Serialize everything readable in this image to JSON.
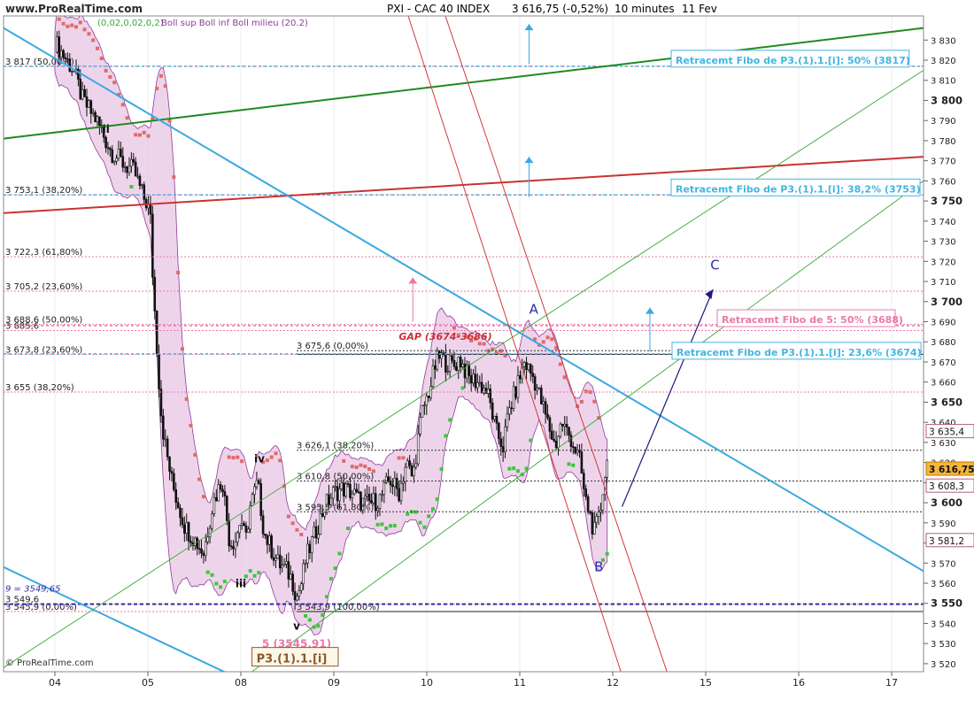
{
  "chart_data": {
    "type": "line",
    "title": "PXI - CAC 40 INDEX",
    "quote": "3 616,75 (-0,52%)",
    "timeframe": "10 minutes",
    "date": "11 Fev",
    "brand": "www.ProRealTime.com",
    "copyright": "© ProRealTime.com",
    "indicator_label": "Boll sup Boll inf Boll milieu (20.2)",
    "indicator_params": "(0,02,0,02,0,2)",
    "ylim": [
      3516,
      3842
    ],
    "y_ticks": [
      3520,
      3530,
      3540,
      3550,
      3560,
      3570,
      3580,
      3590,
      3600,
      3610,
      3620,
      3630,
      3640,
      3650,
      3660,
      3670,
      3680,
      3690,
      3700,
      3710,
      3720,
      3730,
      3740,
      3750,
      3760,
      3770,
      3780,
      3790,
      3800,
      3810,
      3820,
      3830
    ],
    "y_tick_labels": [
      "3 520",
      "3 530",
      "3 540",
      "3 550",
      "3 560",
      "3 570",
      "3 580",
      "3 590",
      "3 600",
      "3 610",
      "3 620",
      "3 630",
      "3 640",
      "3 650",
      "3 660",
      "3 670",
      "3 680",
      "3 690",
      "3 700",
      "3 710",
      "3 720",
      "3 730",
      "3 740",
      "3 750",
      "3 760",
      "3 770",
      "3 780",
      "3 790",
      "3 800",
      "3 810",
      "3 820",
      "3 830"
    ],
    "y_bold_ticks": [
      3550,
      3600,
      3650,
      3700,
      3750,
      3800
    ],
    "x_ticks": [
      0,
      1,
      2,
      3,
      4,
      5,
      6,
      7,
      8,
      9
    ],
    "x_tick_labels": [
      "04",
      "05",
      "08",
      "09",
      "10",
      "11",
      "12",
      "15",
      "16",
      "17"
    ],
    "price_path": [
      [
        0.0,
        3829
      ],
      [
        0.1,
        3822
      ],
      [
        0.2,
        3815
      ],
      [
        0.3,
        3800
      ],
      [
        0.45,
        3790
      ],
      [
        0.6,
        3775
      ],
      [
        0.75,
        3768
      ],
      [
        0.85,
        3765
      ],
      [
        0.95,
        3752
      ],
      [
        1.0,
        3748
      ],
      [
        1.03,
        3740
      ],
      [
        1.05,
        3715
      ],
      [
        1.08,
        3690
      ],
      [
        1.12,
        3660
      ],
      [
        1.15,
        3640
      ],
      [
        1.2,
        3625
      ],
      [
        1.26,
        3610
      ],
      [
        1.32,
        3600
      ],
      [
        1.4,
        3588
      ],
      [
        1.5,
        3582
      ],
      [
        1.6,
        3575
      ],
      [
        1.7,
        3600
      ],
      [
        1.8,
        3612
      ],
      [
        1.88,
        3580
      ],
      [
        1.95,
        3582
      ],
      [
        2.0,
        3593
      ],
      [
        2.05,
        3580
      ],
      [
        2.1,
        3598
      ],
      [
        2.18,
        3610
      ],
      [
        2.25,
        3585
      ],
      [
        2.32,
        3578
      ],
      [
        2.4,
        3570
      ],
      [
        2.5,
        3566
      ],
      [
        2.55,
        3562
      ],
      [
        2.6,
        3553
      ],
      [
        2.65,
        3560
      ],
      [
        2.7,
        3572
      ],
      [
        2.8,
        3585
      ],
      [
        2.9,
        3598
      ],
      [
        3.0,
        3605
      ],
      [
        3.1,
        3607
      ],
      [
        3.2,
        3605
      ],
      [
        3.3,
        3600
      ],
      [
        3.4,
        3600
      ],
      [
        3.5,
        3602
      ],
      [
        3.6,
        3612
      ],
      [
        3.7,
        3605
      ],
      [
        3.78,
        3620
      ],
      [
        3.85,
        3612
      ],
      [
        3.9,
        3630
      ],
      [
        3.95,
        3645
      ],
      [
        4.0,
        3652
      ],
      [
        4.05,
        3660
      ],
      [
        4.1,
        3670
      ],
      [
        4.15,
        3673
      ],
      [
        4.2,
        3670
      ],
      [
        4.3,
        3668
      ],
      [
        4.35,
        3672
      ],
      [
        4.45,
        3662
      ],
      [
        4.55,
        3660
      ],
      [
        4.65,
        3655
      ],
      [
        4.75,
        3635
      ],
      [
        4.82,
        3628
      ],
      [
        4.88,
        3645
      ],
      [
        4.95,
        3655
      ],
      [
        5.05,
        3670
      ],
      [
        5.15,
        3662
      ],
      [
        5.2,
        3655
      ],
      [
        5.3,
        3640
      ],
      [
        5.38,
        3628
      ],
      [
        5.45,
        3640
      ],
      [
        5.55,
        3632
      ],
      [
        5.65,
        3620
      ],
      [
        5.7,
        3602
      ],
      [
        5.75,
        3595
      ],
      [
        5.8,
        3585
      ],
      [
        5.85,
        3592
      ],
      [
        5.88,
        3600
      ],
      [
        5.9,
        3610
      ],
      [
        5.94,
        3620
      ]
    ],
    "fib_levels": [
      {
        "y": 3817,
        "label": "3 817 (50,00%)"
      },
      {
        "y": 3753.1,
        "label": "3 753,1 (38,20%)"
      },
      {
        "y": 3722.3,
        "label": "3 722,3 (61,80%)"
      },
      {
        "y": 3705.2,
        "label": "3 705,2 (23,60%)"
      },
      {
        "y": 3688.6,
        "label": "3 688,6 (50,00%)"
      },
      {
        "y": 3685.6,
        "label": "3 685,6"
      },
      {
        "y": 3673.8,
        "label": "3 673,8 (23,60%)"
      },
      {
        "y": 3655,
        "label": "3 655 (38,20%)"
      },
      {
        "y": 3549.6,
        "label": "3 549,6"
      },
      {
        "y": 3545.9,
        "label": "3 545,9 (0,00%)"
      }
    ],
    "fib_levels_mid": [
      {
        "y": 3675.6,
        "label": "3 675,6 (0,00%)"
      },
      {
        "y": 3626.1,
        "label": "3 626,1 (38,20%)"
      },
      {
        "y": 3610.8,
        "label": "3 610,8 (50,00%)"
      },
      {
        "y": 3595.5,
        "label": "3 595,5 (61,80%)"
      },
      {
        "y": 3545.9,
        "label": "3 543,9 (100,00%)"
      }
    ],
    "retracement_boxes": [
      {
        "y": 3817,
        "label": "Retracemt Fibo de P3.(1).1.[i]: 50% (3817)",
        "color": "#44b4e0"
      },
      {
        "y": 3753,
        "label": "Retracemt Fibo de P3.(1).1.[i]: 38,2% (3753)",
        "color": "#44b4e0"
      },
      {
        "y": 3688,
        "label": "Retracemt Fibo de 5: 50% (3688)",
        "color": "#e87aa8"
      },
      {
        "y": 3674,
        "label": "Retracemt Fibo de P3.(1).1.[i]: 23,6% (3674)",
        "color": "#44b4e0"
      }
    ],
    "price_tags": [
      {
        "y": 3635.4,
        "label": "3 635,4",
        "highlight": false
      },
      {
        "y": 3616.75,
        "label": "3 616,75",
        "highlight": true
      },
      {
        "y": 3608.3,
        "label": "3 608,3",
        "highlight": false
      },
      {
        "y": 3581.2,
        "label": "3 581,2",
        "highlight": false
      }
    ],
    "gap_label": "GAP (3674-3686)",
    "low_marker": "9 = 3549,65",
    "wave_labels": [
      {
        "text": "ii",
        "x": 0.55,
        "y": 3784
      },
      {
        "text": "iv",
        "x": 2.2,
        "y": 3620
      },
      {
        "text": "iii",
        "x": 2.0,
        "y": 3558
      },
      {
        "text": "v",
        "x": 2.6,
        "y": 3537
      },
      {
        "text": "A",
        "x": 5.15,
        "y": 3694
      },
      {
        "text": "B",
        "x": 5.85,
        "y": 3566
      },
      {
        "text": "C",
        "x": 7.1,
        "y": 3716
      }
    ],
    "target_label": "5 (3545,91)",
    "box_label": "P3.(1).1.[i]",
    "colors": {
      "candle": "#111111",
      "bollinger_fill": "#e8c6e4",
      "bollinger_line": "#8e3a9a",
      "sar_red": "#e06a6a",
      "sar_green": "#3cc83c",
      "fib_cyan": "#3aa8e0",
      "fib_pink": "#e87aa8",
      "trend_green": "#1f8a1f",
      "trend_red": "#c83232",
      "channel_red": "#d03a3a",
      "channel_green": "#39a839",
      "wave_blue": "#2c2ca8",
      "arrow_navy": "#1a1a7a"
    }
  }
}
